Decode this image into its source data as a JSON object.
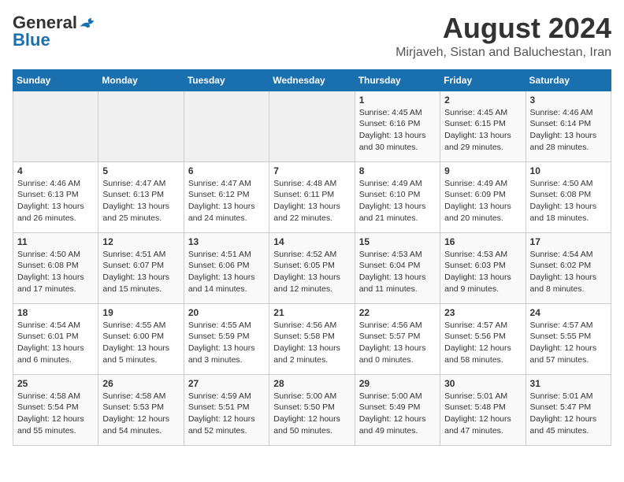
{
  "logo": {
    "general": "General",
    "blue": "Blue"
  },
  "title": "August 2024",
  "subtitle": "Mirjaveh, Sistan and Baluchestan, Iran",
  "days_of_week": [
    "Sunday",
    "Monday",
    "Tuesday",
    "Wednesday",
    "Thursday",
    "Friday",
    "Saturday"
  ],
  "weeks": [
    [
      {
        "day": "",
        "info": ""
      },
      {
        "day": "",
        "info": ""
      },
      {
        "day": "",
        "info": ""
      },
      {
        "day": "",
        "info": ""
      },
      {
        "day": "1",
        "info": "Sunrise: 4:45 AM\nSunset: 6:16 PM\nDaylight: 13 hours and 30 minutes."
      },
      {
        "day": "2",
        "info": "Sunrise: 4:45 AM\nSunset: 6:15 PM\nDaylight: 13 hours and 29 minutes."
      },
      {
        "day": "3",
        "info": "Sunrise: 4:46 AM\nSunset: 6:14 PM\nDaylight: 13 hours and 28 minutes."
      }
    ],
    [
      {
        "day": "4",
        "info": "Sunrise: 4:46 AM\nSunset: 6:13 PM\nDaylight: 13 hours and 26 minutes."
      },
      {
        "day": "5",
        "info": "Sunrise: 4:47 AM\nSunset: 6:13 PM\nDaylight: 13 hours and 25 minutes."
      },
      {
        "day": "6",
        "info": "Sunrise: 4:47 AM\nSunset: 6:12 PM\nDaylight: 13 hours and 24 minutes."
      },
      {
        "day": "7",
        "info": "Sunrise: 4:48 AM\nSunset: 6:11 PM\nDaylight: 13 hours and 22 minutes."
      },
      {
        "day": "8",
        "info": "Sunrise: 4:49 AM\nSunset: 6:10 PM\nDaylight: 13 hours and 21 minutes."
      },
      {
        "day": "9",
        "info": "Sunrise: 4:49 AM\nSunset: 6:09 PM\nDaylight: 13 hours and 20 minutes."
      },
      {
        "day": "10",
        "info": "Sunrise: 4:50 AM\nSunset: 6:08 PM\nDaylight: 13 hours and 18 minutes."
      }
    ],
    [
      {
        "day": "11",
        "info": "Sunrise: 4:50 AM\nSunset: 6:08 PM\nDaylight: 13 hours and 17 minutes."
      },
      {
        "day": "12",
        "info": "Sunrise: 4:51 AM\nSunset: 6:07 PM\nDaylight: 13 hours and 15 minutes."
      },
      {
        "day": "13",
        "info": "Sunrise: 4:51 AM\nSunset: 6:06 PM\nDaylight: 13 hours and 14 minutes."
      },
      {
        "day": "14",
        "info": "Sunrise: 4:52 AM\nSunset: 6:05 PM\nDaylight: 13 hours and 12 minutes."
      },
      {
        "day": "15",
        "info": "Sunrise: 4:53 AM\nSunset: 6:04 PM\nDaylight: 13 hours and 11 minutes."
      },
      {
        "day": "16",
        "info": "Sunrise: 4:53 AM\nSunset: 6:03 PM\nDaylight: 13 hours and 9 minutes."
      },
      {
        "day": "17",
        "info": "Sunrise: 4:54 AM\nSunset: 6:02 PM\nDaylight: 13 hours and 8 minutes."
      }
    ],
    [
      {
        "day": "18",
        "info": "Sunrise: 4:54 AM\nSunset: 6:01 PM\nDaylight: 13 hours and 6 minutes."
      },
      {
        "day": "19",
        "info": "Sunrise: 4:55 AM\nSunset: 6:00 PM\nDaylight: 13 hours and 5 minutes."
      },
      {
        "day": "20",
        "info": "Sunrise: 4:55 AM\nSunset: 5:59 PM\nDaylight: 13 hours and 3 minutes."
      },
      {
        "day": "21",
        "info": "Sunrise: 4:56 AM\nSunset: 5:58 PM\nDaylight: 13 hours and 2 minutes."
      },
      {
        "day": "22",
        "info": "Sunrise: 4:56 AM\nSunset: 5:57 PM\nDaylight: 13 hours and 0 minutes."
      },
      {
        "day": "23",
        "info": "Sunrise: 4:57 AM\nSunset: 5:56 PM\nDaylight: 12 hours and 58 minutes."
      },
      {
        "day": "24",
        "info": "Sunrise: 4:57 AM\nSunset: 5:55 PM\nDaylight: 12 hours and 57 minutes."
      }
    ],
    [
      {
        "day": "25",
        "info": "Sunrise: 4:58 AM\nSunset: 5:54 PM\nDaylight: 12 hours and 55 minutes."
      },
      {
        "day": "26",
        "info": "Sunrise: 4:58 AM\nSunset: 5:53 PM\nDaylight: 12 hours and 54 minutes."
      },
      {
        "day": "27",
        "info": "Sunrise: 4:59 AM\nSunset: 5:51 PM\nDaylight: 12 hours and 52 minutes."
      },
      {
        "day": "28",
        "info": "Sunrise: 5:00 AM\nSunset: 5:50 PM\nDaylight: 12 hours and 50 minutes."
      },
      {
        "day": "29",
        "info": "Sunrise: 5:00 AM\nSunset: 5:49 PM\nDaylight: 12 hours and 49 minutes."
      },
      {
        "day": "30",
        "info": "Sunrise: 5:01 AM\nSunset: 5:48 PM\nDaylight: 12 hours and 47 minutes."
      },
      {
        "day": "31",
        "info": "Sunrise: 5:01 AM\nSunset: 5:47 PM\nDaylight: 12 hours and 45 minutes."
      }
    ]
  ]
}
